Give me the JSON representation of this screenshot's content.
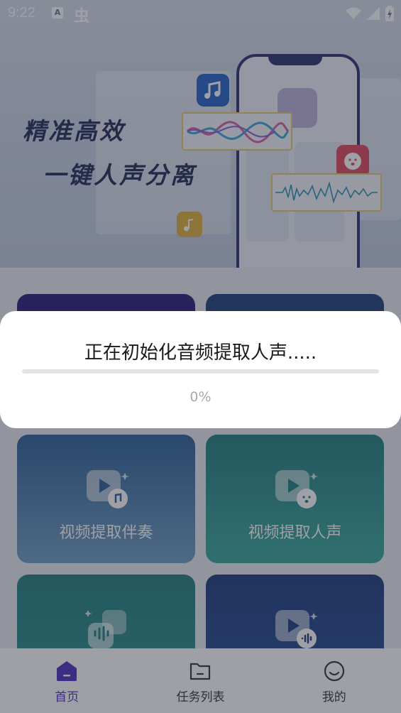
{
  "status_bar": {
    "time": "9:22",
    "a_badge": "A",
    "bug_glyph": "虫",
    "icons": [
      "wifi-icon",
      "signal-icon",
      "battery-icon"
    ]
  },
  "hero": {
    "title_line1": "精准高效",
    "title_line2": "一键人声分离"
  },
  "cards": [
    {
      "label": "",
      "colors": [
        "#2a1c7a",
        "#23186b"
      ]
    },
    {
      "label": "",
      "colors": [
        "#1e3f7a",
        "#1a3a72"
      ]
    },
    {
      "label": "视频提取伴奏",
      "colors": [
        "#2c5f96",
        "#5f8fb6"
      ],
      "icon": "video-music-icon"
    },
    {
      "label": "视频提取人声",
      "colors": [
        "#1f7d7d",
        "#2f9a93"
      ],
      "icon": "video-voice-icon"
    },
    {
      "label": "",
      "colors": [
        "#1f7d7d",
        "#2a8f8b"
      ],
      "icon": "audio-wave-icon"
    },
    {
      "label": "",
      "colors": [
        "#1c3a7e",
        "#244a90"
      ],
      "icon": "video-audio-icon"
    }
  ],
  "dialog": {
    "title": "正在初始化音频提取人声.....",
    "percent_label": "0%",
    "progress": 0
  },
  "nav": [
    {
      "label": "首页",
      "icon": "home-icon",
      "active": true
    },
    {
      "label": "任务列表",
      "icon": "folder-icon",
      "active": false
    },
    {
      "label": "我的",
      "icon": "smile-icon",
      "active": false
    }
  ],
  "colors": {
    "accent": "#4b2ec2"
  }
}
